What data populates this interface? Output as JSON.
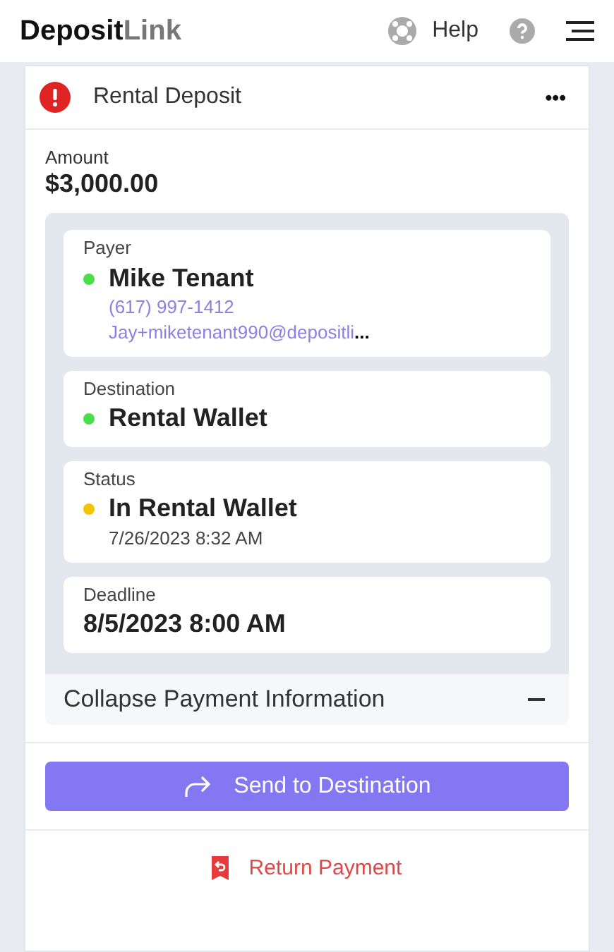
{
  "header": {
    "logo_primary": "Deposit",
    "logo_secondary": "Link",
    "help_label": "Help"
  },
  "card": {
    "title": "Rental Deposit",
    "alert": true,
    "menu": "•••",
    "amount_label": "Amount",
    "amount": "$3,000.00",
    "sections": [
      {
        "label": "Payer",
        "color": "#4ade4a",
        "value": "Mike Tenant",
        "lines": [
          {
            "kind": "link",
            "text": "(617) 997-1412"
          },
          {
            "kind": "link",
            "text": "Jay+miketenant990@depositli",
            "cut": "..."
          }
        ]
      },
      {
        "label": "Destination",
        "color": "#4ade4a",
        "value": "Rental Wallet"
      },
      {
        "label": "Status",
        "color": "#f5c400",
        "value": "In Rental Wallet",
        "lines": [
          {
            "kind": "text",
            "text": "7/26/2023 8:32 AM"
          }
        ]
      },
      {
        "label": "Deadline",
        "value": "8/5/2023 8:00 AM"
      }
    ],
    "collapse": {
      "label": "Collapse Payment Information",
      "expanded": true
    },
    "send_button": "Send to Destination",
    "return_button": "Return Payment"
  }
}
